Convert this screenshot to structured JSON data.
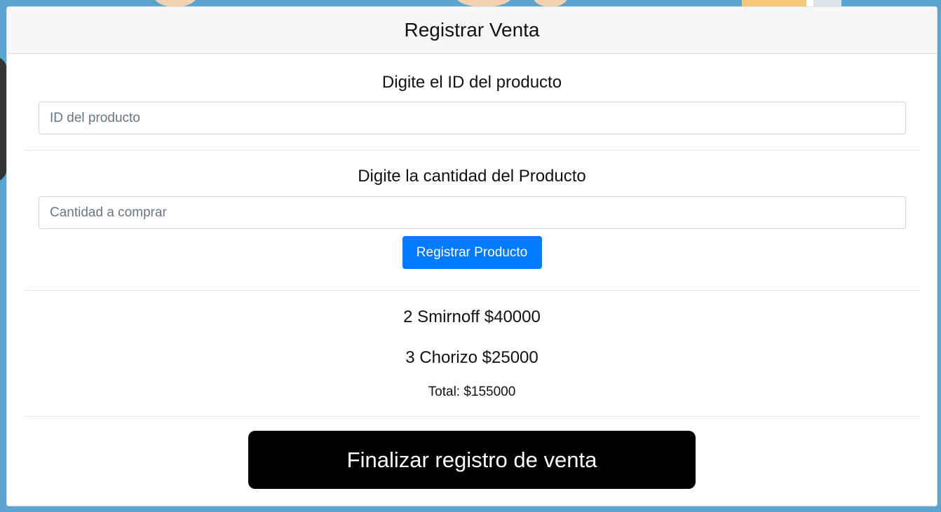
{
  "header": {
    "title": "Registrar Venta"
  },
  "product_id": {
    "label": "Digite el ID del producto",
    "placeholder": "ID del producto",
    "value": ""
  },
  "quantity": {
    "label": "Digite la cantidad del Producto",
    "placeholder": "Cantidad a comprar",
    "value": ""
  },
  "register_button": {
    "label": "Registrar Producto",
    "color": "#007bff"
  },
  "items": [
    {
      "text": "2 Smirnoff $40000"
    },
    {
      "text": "3 Chorizo $25000"
    }
  ],
  "total": {
    "text": "Total: $155000"
  },
  "finalize_button": {
    "label": "Finalizar registro de venta",
    "color": "#000000"
  },
  "colors": {
    "page_background": "#5ba4cf",
    "header_background": "#f7f7f7"
  }
}
